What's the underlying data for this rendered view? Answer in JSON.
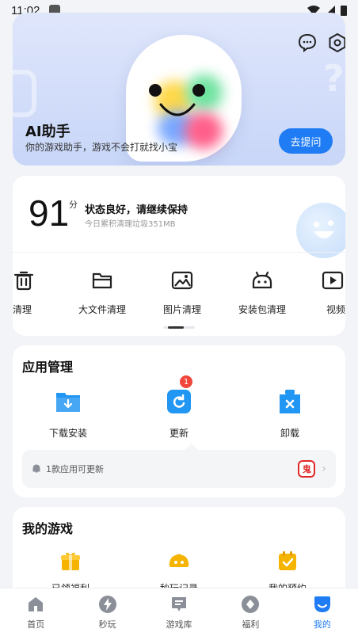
{
  "status_bar": {
    "time": "11:02"
  },
  "hero": {
    "title": "AI助手",
    "subtitle": "你的游戏助手，游戏不会打就找小宝",
    "ask_button": "去提问",
    "deco_mark": "?"
  },
  "score": {
    "value": "91",
    "unit": "分",
    "status": "状态良好，请继续保持",
    "sub": "今日累积清理垃圾351MB"
  },
  "tools": [
    {
      "label": "垃圾清理",
      "icon": "trash-icon"
    },
    {
      "label": "大文件清理",
      "icon": "folder-icon"
    },
    {
      "label": "图片清理",
      "icon": "image-icon"
    },
    {
      "label": "安装包清理",
      "icon": "android-icon"
    },
    {
      "label": "视频清理",
      "icon": "video-icon"
    }
  ],
  "app_management": {
    "title": "应用管理",
    "items": [
      {
        "label": "下载安装",
        "icon": "download-folder-icon"
      },
      {
        "label": "更新",
        "icon": "update-icon",
        "badge": "1"
      },
      {
        "label": "卸载",
        "icon": "uninstall-icon"
      }
    ],
    "update_notice": "1款应用可更新",
    "update_app_icon_text": "鬼"
  },
  "my_games": {
    "title": "我的游戏",
    "items": [
      {
        "label": "已领福利",
        "icon": "gift-icon"
      },
      {
        "label": "秒玩记录",
        "icon": "gamepad-icon"
      },
      {
        "label": "我的预约",
        "icon": "calendar-check-icon"
      }
    ]
  },
  "bottom_nav": [
    {
      "label": "首页",
      "icon": "home-icon"
    },
    {
      "label": "秒玩",
      "icon": "lightning-icon"
    },
    {
      "label": "游戏库",
      "icon": "library-icon"
    },
    {
      "label": "福利",
      "icon": "gift-nav-icon"
    },
    {
      "label": "我的",
      "icon": "profile-icon",
      "active": true
    }
  ],
  "colors": {
    "accent": "#1f7cf4",
    "badge": "#f0463c",
    "folder": "#2196f3",
    "game_yellow": "#f5b400"
  }
}
